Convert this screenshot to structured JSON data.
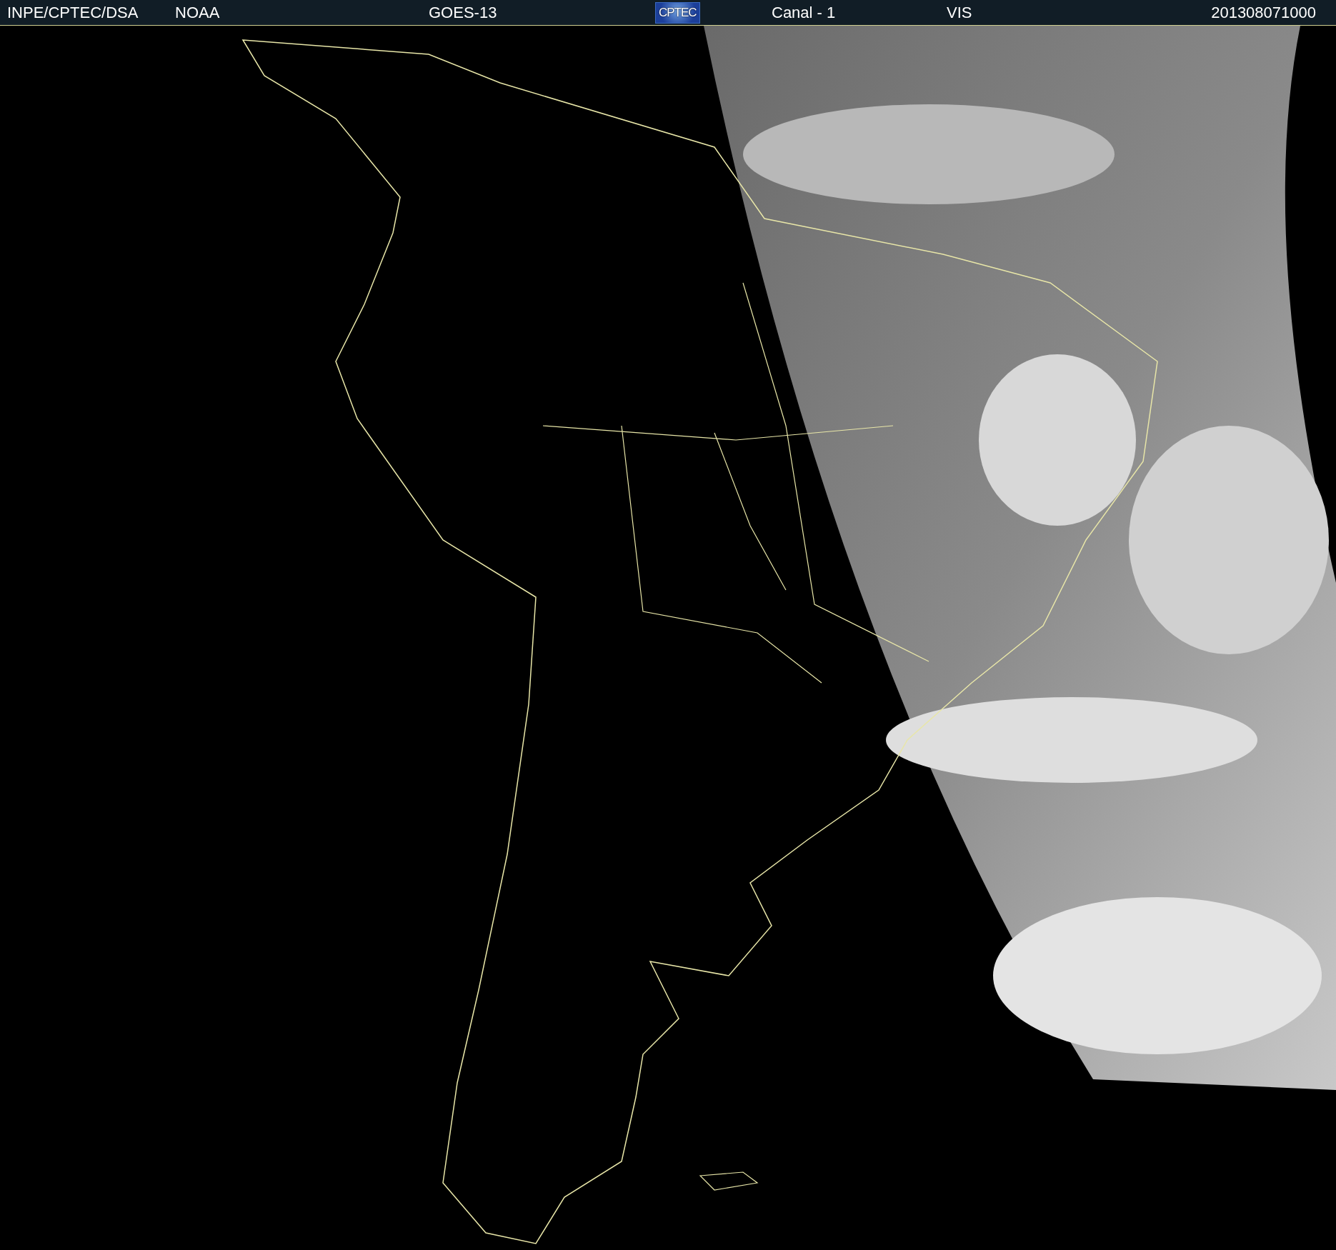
{
  "header": {
    "items": [
      {
        "kind": "text",
        "text": "INPE/CPTEC/DSA"
      },
      {
        "kind": "text",
        "text": "NOAA"
      },
      {
        "kind": "text",
        "text": "GOES-13"
      },
      {
        "kind": "logo",
        "text": "CPTEC"
      },
      {
        "kind": "text",
        "text": "Canal - 1"
      },
      {
        "kind": "text",
        "text": "VIS"
      },
      {
        "kind": "text",
        "text": "201308071000"
      }
    ]
  }
}
